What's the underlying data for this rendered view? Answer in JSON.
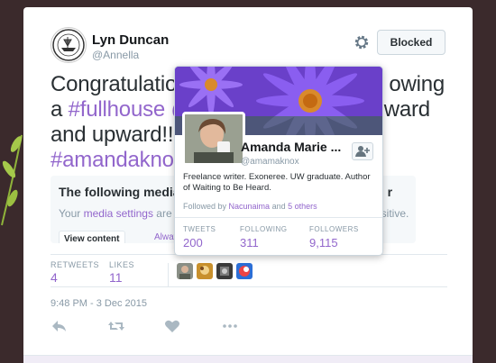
{
  "user": {
    "name": "Lyn Duncan",
    "handle": "@Annella",
    "blocked_label": "Blocked"
  },
  "tweet": {
    "line1": "Congratulation",
    "line1_tail": "owing",
    "line2_a": "a ",
    "hashtag1": "#fullhouse",
    "line2_mention": "@",
    "line2_tail": "ward",
    "line3": "and upward!!",
    "hashtag2": "#amandaknox"
  },
  "media_warning": {
    "title": "The following media",
    "title_tail": "r",
    "body_pre": "Your ",
    "body_link": "media settings",
    "body_post": " are co",
    "body_tail": "nsitive.",
    "view_button": "View content",
    "always_show": "Always show"
  },
  "stats": {
    "retweets_label": "RETWEETS",
    "retweets": "4",
    "likes_label": "LIKES",
    "likes": "11"
  },
  "timestamp": "9:48 PM - 3 Dec 2015",
  "profile_card": {
    "name": "Amanda Marie ...",
    "handle": "@amamaknox",
    "bio": "Freelance writer. Exoneree. UW graduate. Author of Waiting to Be Heard.",
    "followed_by_prefix": "Followed by ",
    "followed_by_user": "Nacunaima",
    "followed_by_and": " and ",
    "followed_by_others": "5 others",
    "tweets_label": "TWEETS",
    "tweets": "200",
    "following_label": "FOLLOWING",
    "following": "311",
    "followers_label": "FOLLOWERS",
    "followers": "9,115"
  },
  "icons": [
    "gear-icon",
    "follow-person-icon",
    "reply-icon",
    "retweet-icon",
    "like-icon",
    "more-icon"
  ],
  "colors": {
    "accent": "#9266cc",
    "background": "#3b2a2c",
    "muted": "#8899a6"
  }
}
